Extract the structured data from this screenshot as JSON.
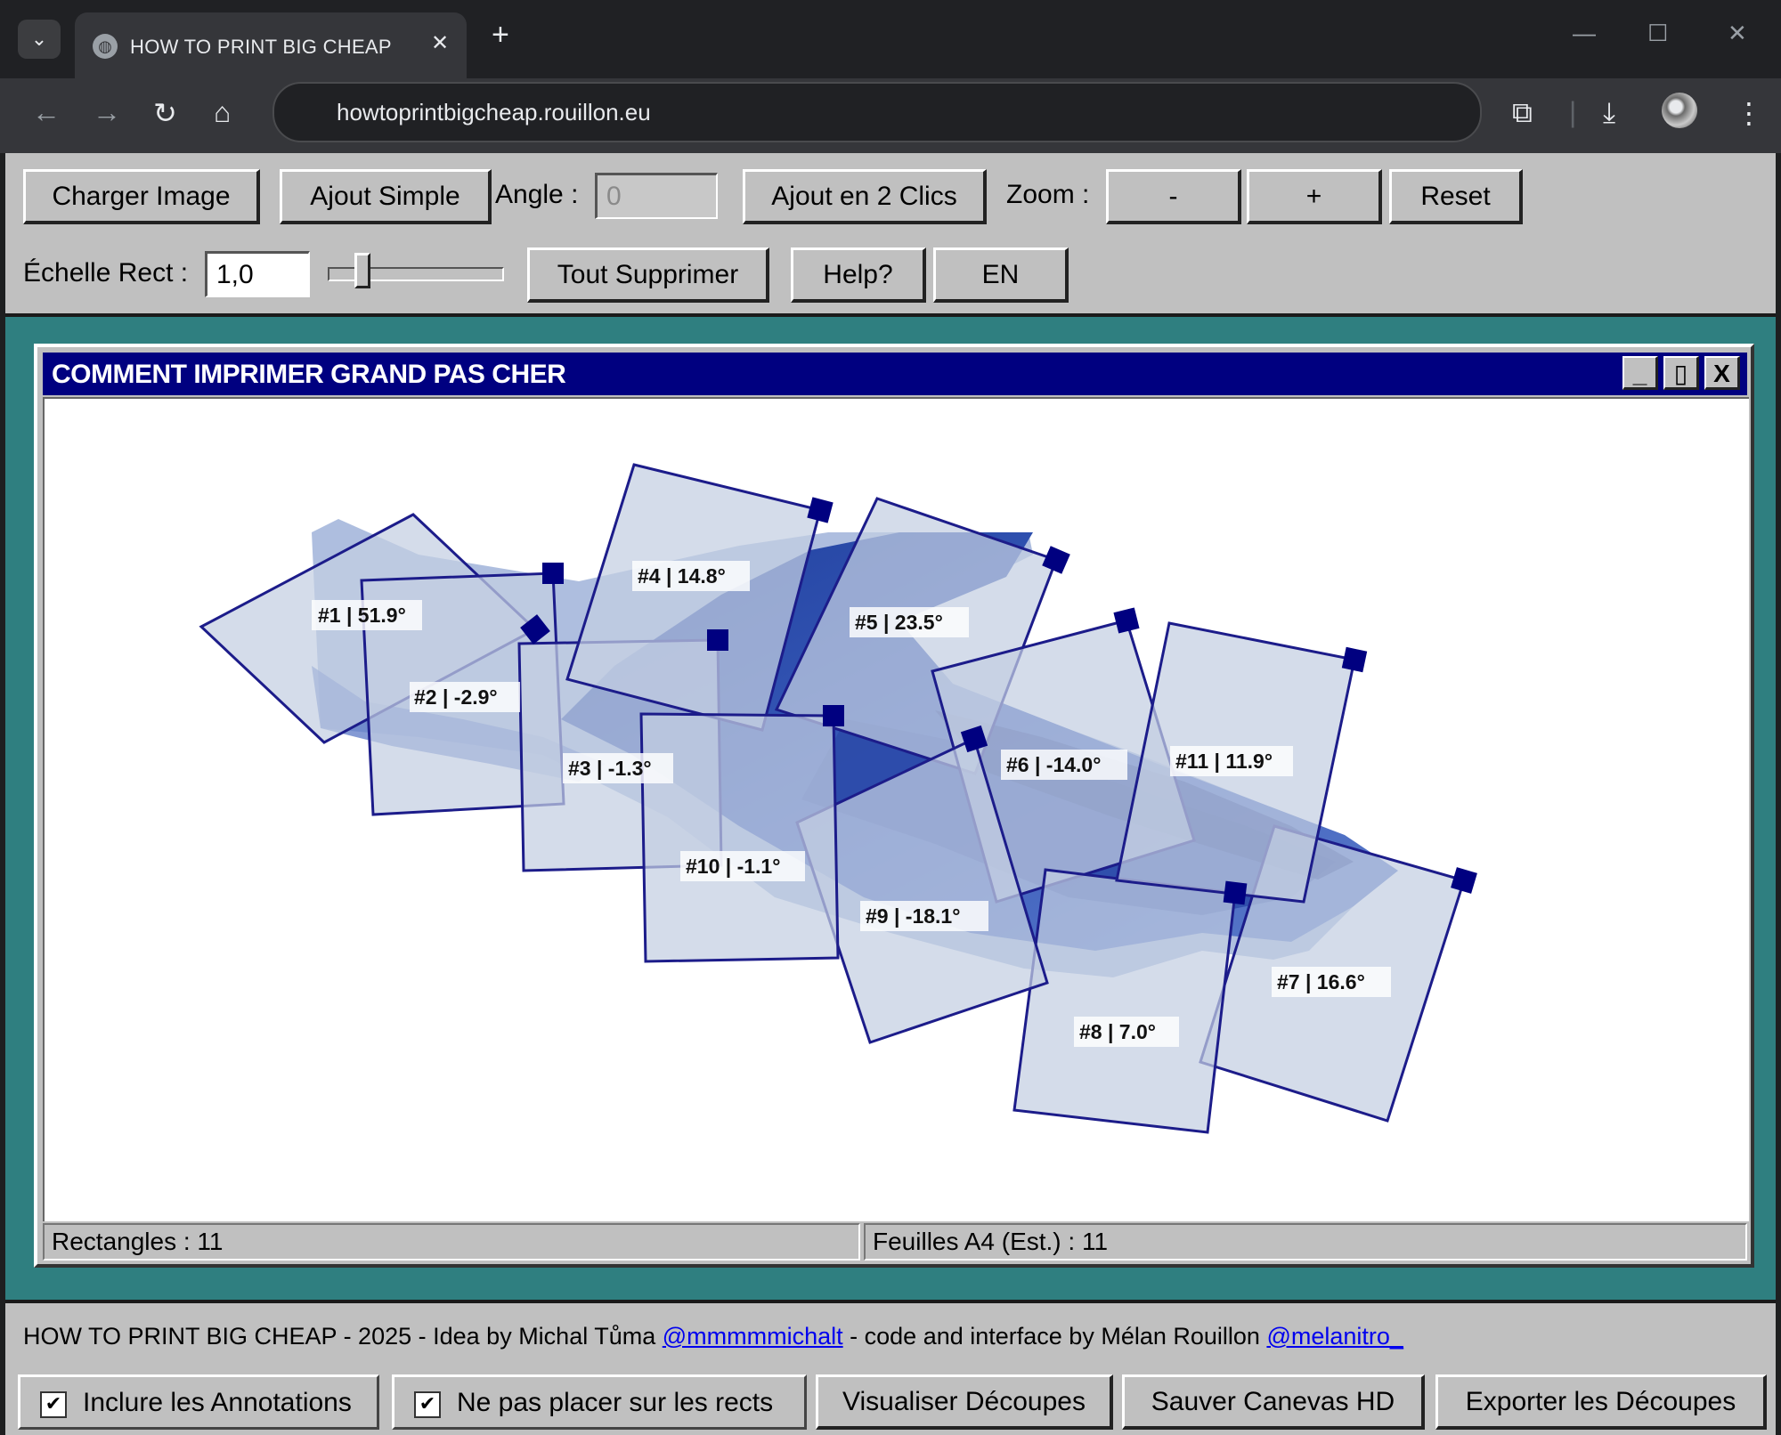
{
  "browser": {
    "tab_title": "HOW TO PRINT BIG CHEAP",
    "url": "howtoprintbigcheap.rouillon.eu"
  },
  "toolbar": {
    "load_image": "Charger Image",
    "simple_add": "Ajout Simple",
    "angle_label": "Angle :",
    "angle_value": "0",
    "two_click_add": "Ajout en 2 Clics",
    "zoom_label": "Zoom :",
    "zoom_out": "-",
    "zoom_in": "+",
    "reset": "Reset",
    "rect_scale_label": "Échelle Rect :",
    "rect_scale_value": "1,0",
    "rect_scale_slider": 0.2,
    "delete_all": "Tout Supprimer",
    "help": "Help?",
    "language": "EN"
  },
  "window": {
    "title": "COMMENT IMPRIMER GRAND PAS CHER",
    "minimize": "_",
    "maximize": "▯",
    "close": "X"
  },
  "rectangles": [
    {
      "label": "#1 | 51.9°"
    },
    {
      "label": "#2 | -2.9°"
    },
    {
      "label": "#3 | -1.3°"
    },
    {
      "label": "#4 | 14.8°"
    },
    {
      "label": "#5 | 23.5°"
    },
    {
      "label": "#6 | -14.0°"
    },
    {
      "label": "#7 | 16.6°"
    },
    {
      "label": "#8 | 7.0°"
    },
    {
      "label": "#9 | -18.1°"
    },
    {
      "label": "#10 | -1.1°"
    },
    {
      "label": "#11 | 11.9°"
    }
  ],
  "status": {
    "rect_count": "Rectangles : 11",
    "a4_sheets": "Feuilles A4 (Est.) : 11"
  },
  "footer": {
    "credits_prefix": "HOW TO PRINT BIG CHEAP - 2025 - Idea by Michal Tůma ",
    "credits_link1": "@mmmmmichalt",
    "credits_middle": " - code and interface by Mélan Rouillon ",
    "credits_link2": "@melanitro_",
    "include_annotations": "Inclure les Annotations",
    "include_annotations_checked": true,
    "no_place_on_rects": "Ne pas placer sur les rects",
    "no_place_on_rects_checked": true,
    "preview_cuts": "Visualiser Découpes",
    "save_hd": "Sauver Canevas HD",
    "export_cuts": "Exporter les Découpes"
  },
  "colors": {
    "titlebar": "#000080",
    "rect_stroke": "#1c1c8a",
    "rect_fill": "#c9d3e3",
    "image_blue": "#3b5bb5",
    "desktop": "#2f7f80"
  }
}
